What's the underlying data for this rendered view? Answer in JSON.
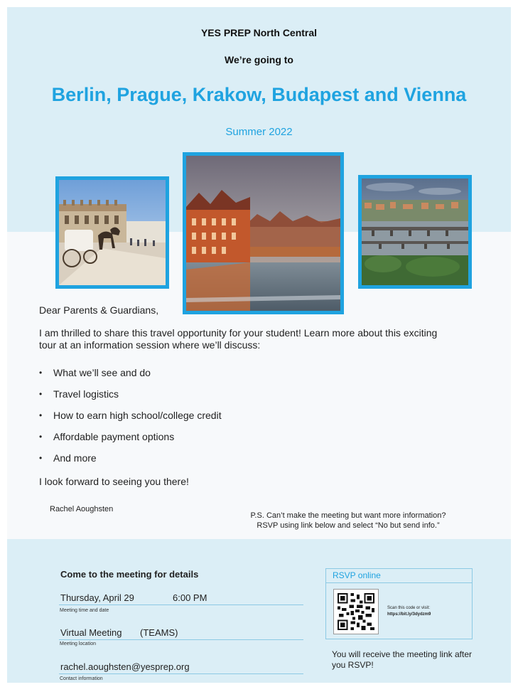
{
  "header": {
    "org": "YES PREP North Central",
    "going": "We’re going to",
    "destinations": "Berlin, Prague, Krakow, Budapest and Vienna",
    "season": "Summer 2022"
  },
  "photos": {
    "left": "krakow-carriage-photo",
    "center": "prague-riverside-photo",
    "right": "prague-bridges-photo"
  },
  "letter": {
    "greeting": "Dear Parents & Guardians,",
    "intro": "I am thrilled to share this travel opportunity for your student! Learn more about this exciting tour at an information session where we’ll discuss:",
    "bullets": [
      "What we’ll see and do",
      "Travel logistics",
      "How to earn high school/college credit",
      "Affordable payment options",
      "And more"
    ],
    "closing": "I look forward to seeing you there!",
    "signer": "Rachel Aoughsten",
    "ps_line1": "P.S. Can’t make the meeting but want more information?",
    "ps_line2": "RSVP using link below and select “No but send info.”"
  },
  "meeting": {
    "title": "Come to the meeting for details",
    "date": "Thursday, April 29",
    "time": "6:00 PM",
    "date_caption": "Meeting time and date",
    "location": "Virtual Meeting",
    "location_note": "(TEAMS)",
    "location_caption": "Meeting location",
    "contact": "rachel.aoughsten@yesprep.org",
    "contact_caption": "Contact information"
  },
  "rsvp": {
    "title": "RSVP online",
    "scan_text": "Scan this code or visit:",
    "url": "https://bit.ly/3dydzm9",
    "qr_icon": "qr-code-icon",
    "after": "You will receive the meeting link after you RSVP!"
  },
  "colors": {
    "accent": "#1fa3e0",
    "band": "#dbeef6",
    "page": "#f7f9fb"
  }
}
